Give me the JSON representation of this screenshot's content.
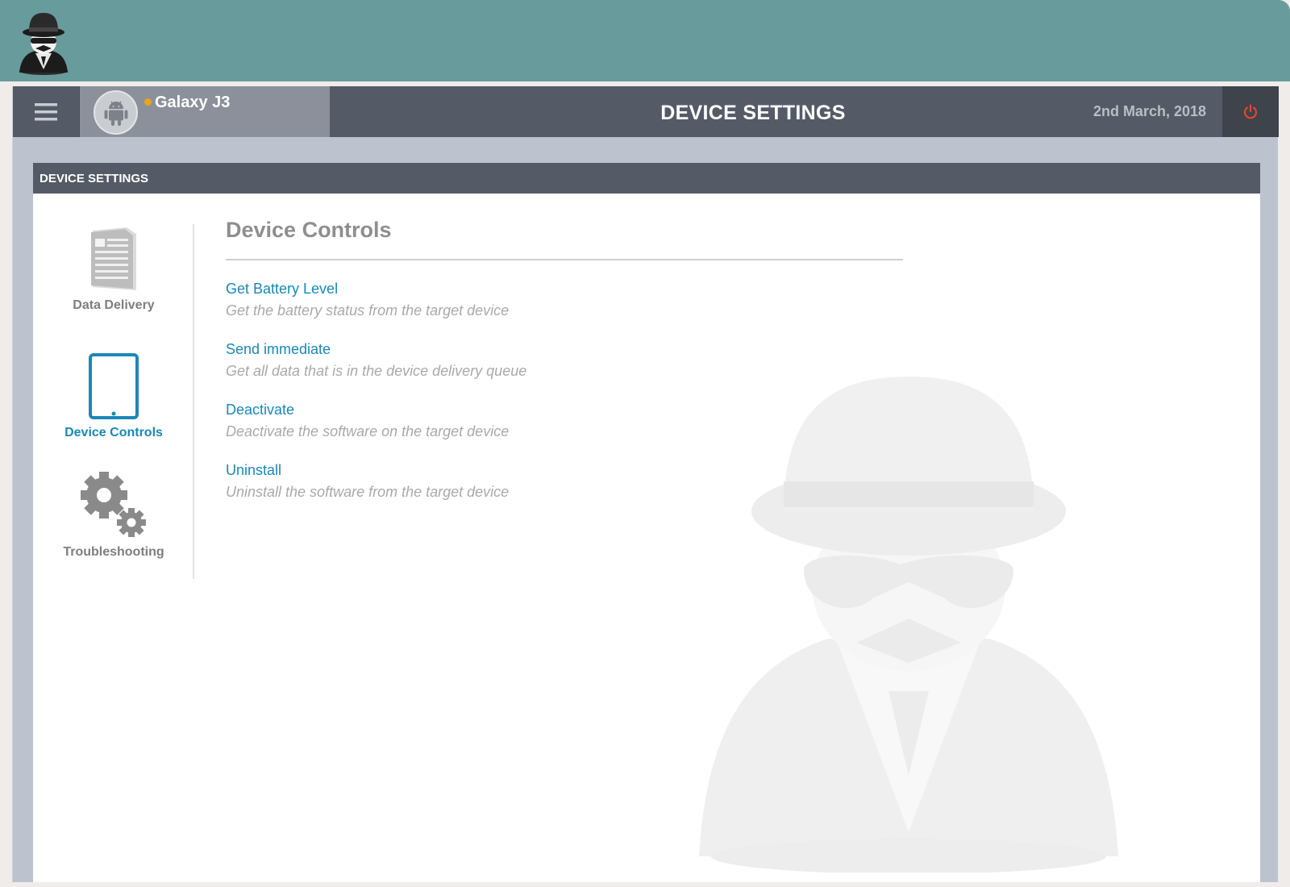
{
  "header": {
    "device_name": "Galaxy J3",
    "page_title": "DEVICE SETTINGS",
    "date": "2nd March, 2018"
  },
  "panel": {
    "title": "DEVICE SETTINGS"
  },
  "side_nav": {
    "items": [
      {
        "label": "Data Delivery",
        "icon": "document-icon",
        "active": false
      },
      {
        "label": "Device Controls",
        "icon": "tablet-icon",
        "active": true
      },
      {
        "label": "Troubleshooting",
        "icon": "gears-icon",
        "active": false
      }
    ]
  },
  "content": {
    "title": "Device Controls",
    "controls": [
      {
        "label": "Get Battery Level",
        "description": "Get the battery status from the target device"
      },
      {
        "label": "Send immediate",
        "description": "Get all data that is in the device delivery queue"
      },
      {
        "label": "Deactivate",
        "description": "Deactivate the software on the target device"
      },
      {
        "label": "Uninstall",
        "description": "Uninstall the software from the target device"
      }
    ]
  },
  "colors": {
    "banner": "#689b9b",
    "nav_bar": "#555b66",
    "accent": "#1b87b7",
    "status_dot": "#f0a21c",
    "power": "#e04a22"
  }
}
